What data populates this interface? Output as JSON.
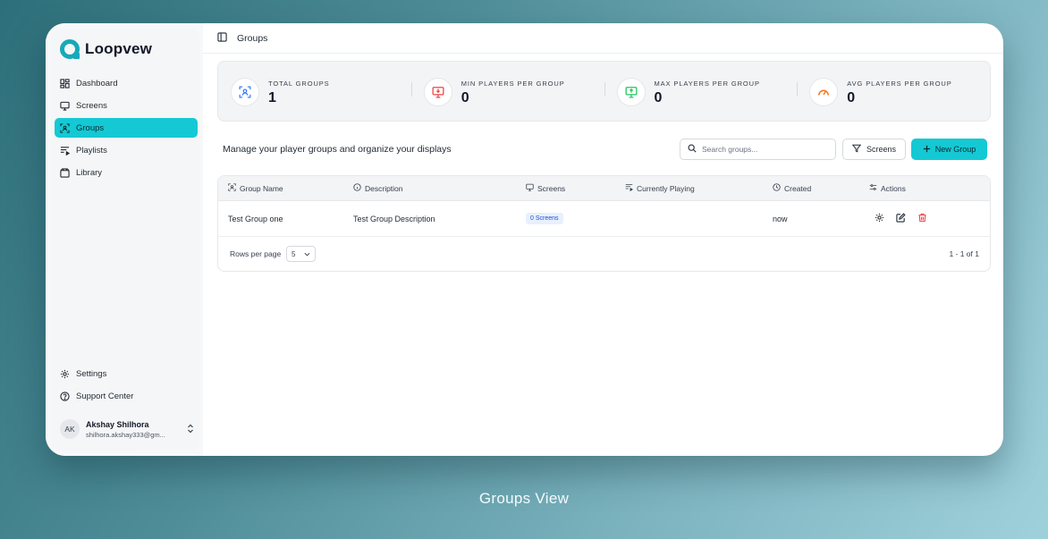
{
  "app": {
    "name": "Loopvew"
  },
  "sidebar": {
    "items": [
      {
        "label": "Dashboard",
        "icon": "dashboard-icon"
      },
      {
        "label": "Screens",
        "icon": "monitor-icon"
      },
      {
        "label": "Groups",
        "icon": "groups-icon",
        "active": true
      },
      {
        "label": "Playlists",
        "icon": "playlist-icon"
      },
      {
        "label": "Library",
        "icon": "library-icon"
      }
    ],
    "bottom": [
      {
        "label": "Settings",
        "icon": "gear-icon"
      },
      {
        "label": "Support Center",
        "icon": "help-icon"
      }
    ],
    "user": {
      "initials": "AK",
      "name": "Akshay Shilhora",
      "email": "shilhora.akshay333@gm..."
    }
  },
  "header": {
    "title": "Groups"
  },
  "stats": [
    {
      "label": "TOTAL GROUPS",
      "value": "1",
      "icon": "groups-icon",
      "color": "#3b82f6"
    },
    {
      "label": "MIN PLAYERS PER GROUP",
      "value": "0",
      "icon": "monitor-down-icon",
      "color": "#ef4444"
    },
    {
      "label": "MAX PLAYERS PER GROUP",
      "value": "0",
      "icon": "monitor-up-icon",
      "color": "#22c55e"
    },
    {
      "label": "AVG PLAYERS PER GROUP",
      "value": "0",
      "icon": "gauge-icon",
      "color": "#f97316"
    }
  ],
  "toolbar": {
    "description": "Manage your player groups and organize your displays",
    "search_placeholder": "Search groups...",
    "filter_label": "Screens",
    "new_label": "New Group"
  },
  "table": {
    "columns": [
      "Group Name",
      "Description",
      "Screens",
      "Currently Playing",
      "Created",
      "Actions"
    ],
    "rows": [
      {
        "name": "Test Group one",
        "description": "Test Group Description",
        "screens": "0 Screens",
        "playing": "",
        "created": "now"
      }
    ],
    "rows_per_page_label": "Rows per page",
    "rows_per_page": "5",
    "pagination": "1 - 1 of 1"
  },
  "caption": "Groups View",
  "colors": {
    "accent": "#14c9d4",
    "brand": "#16a9b9",
    "delete": "#ef4444"
  }
}
